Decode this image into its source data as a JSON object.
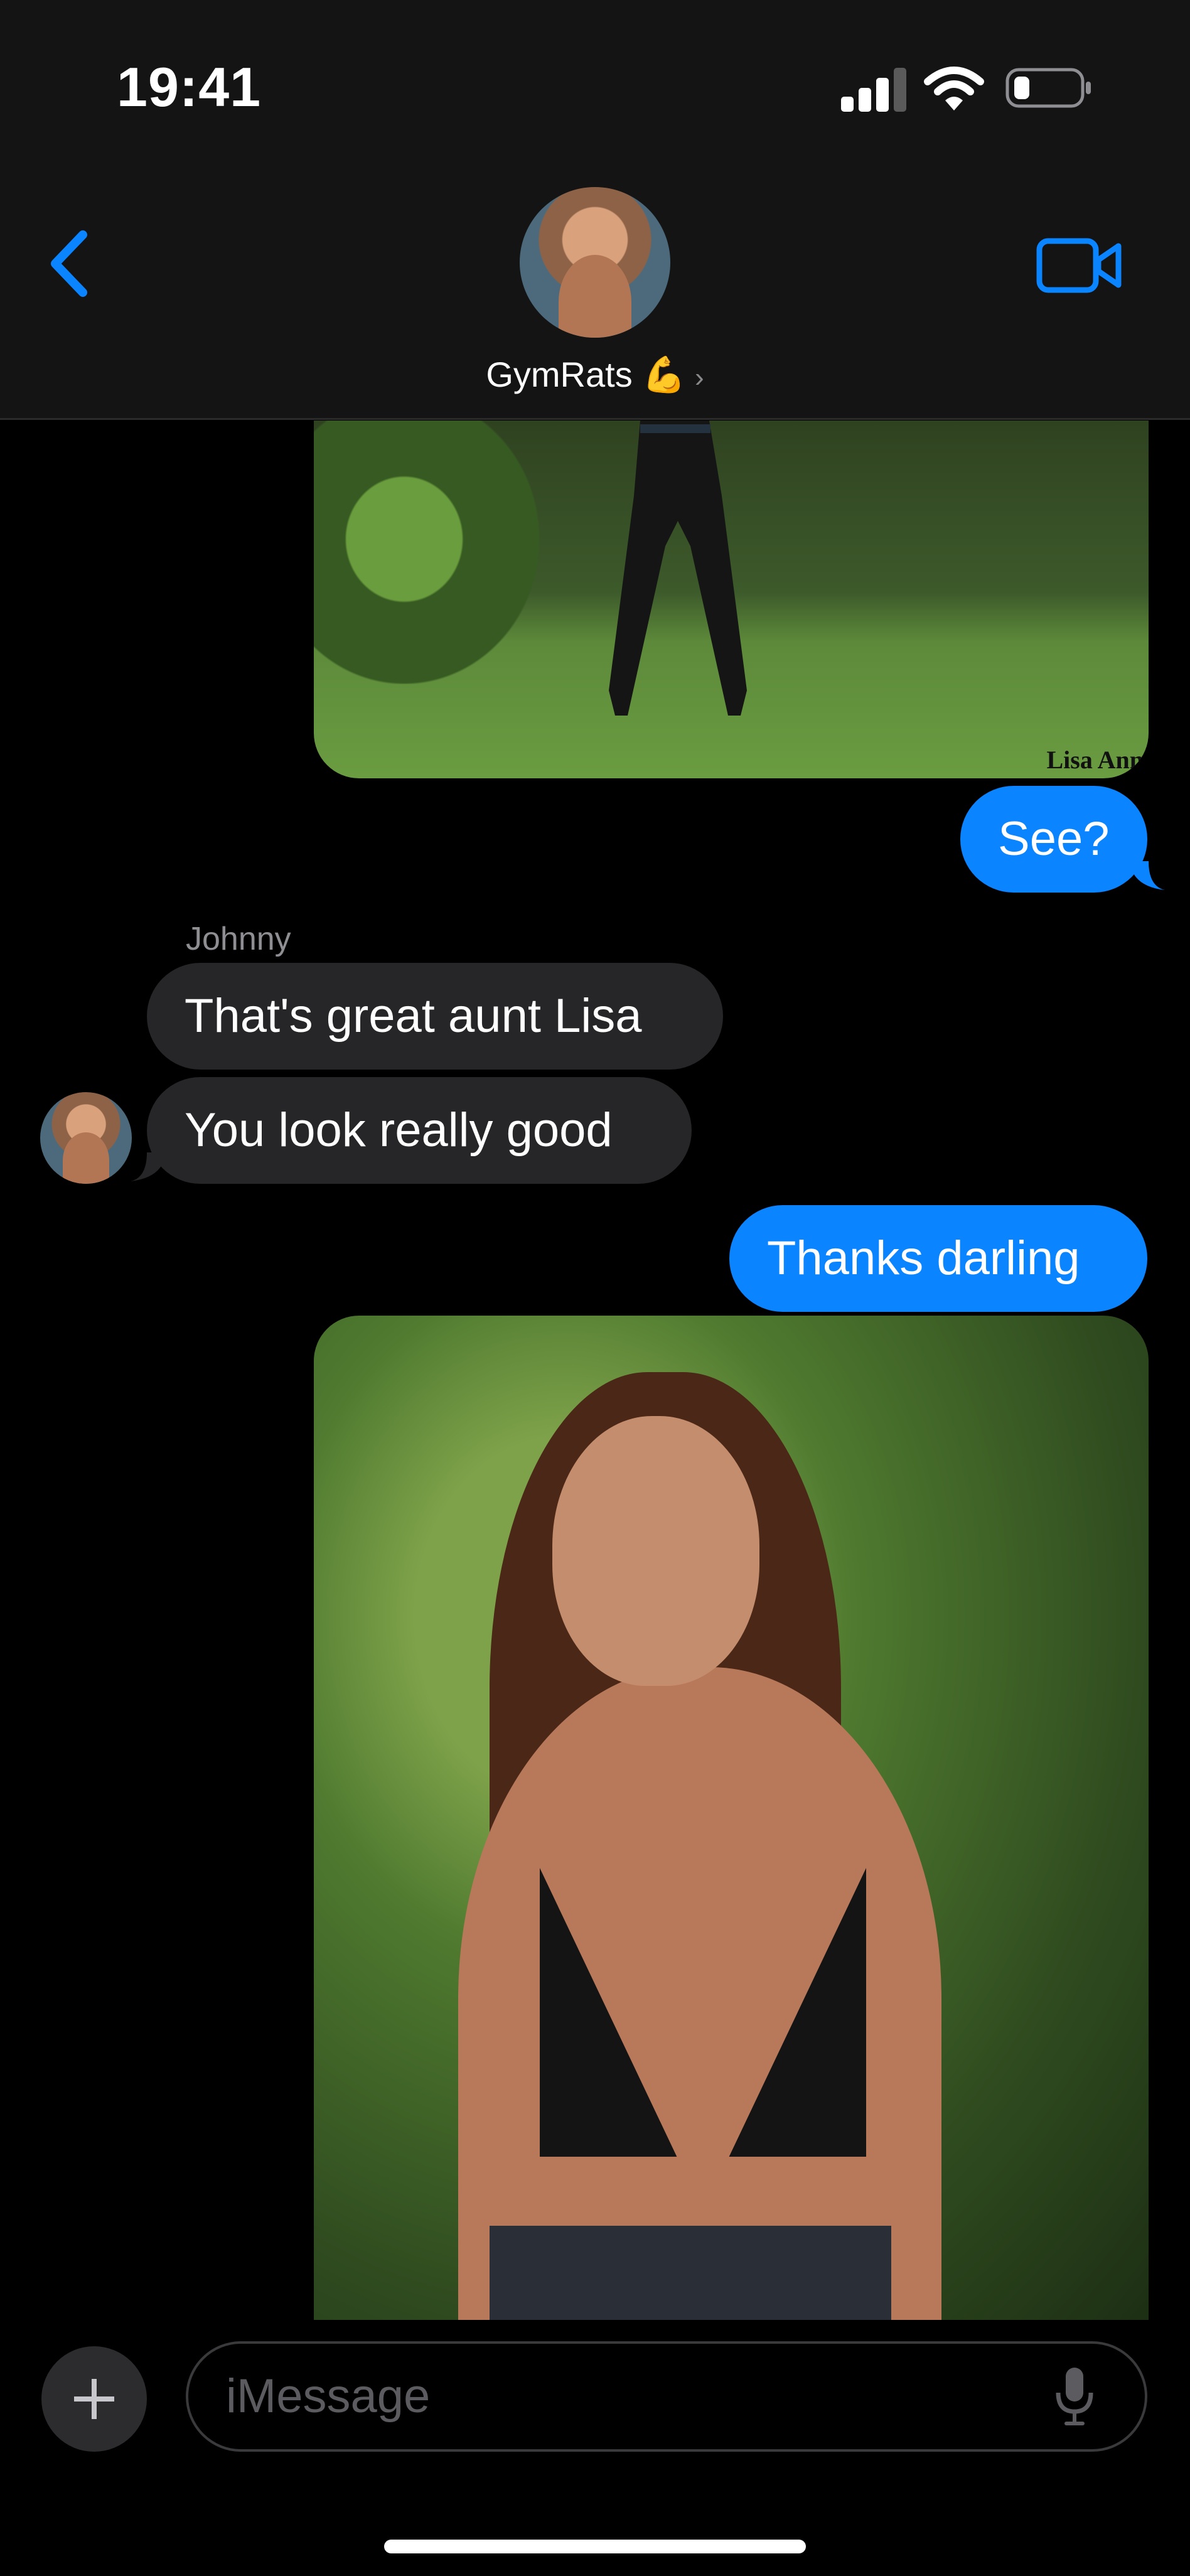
{
  "status_bar": {
    "time": "19:41"
  },
  "header": {
    "group_name": "GymRats 💪",
    "chevron": "›"
  },
  "messages": [
    {
      "type": "image",
      "from": "me",
      "watermark": "Lisa Ann"
    },
    {
      "type": "text",
      "from": "me",
      "text": "See?"
    },
    {
      "type": "sender",
      "text": "Johnny"
    },
    {
      "type": "text",
      "from": "Johnny",
      "text": "That's great aunt Lisa"
    },
    {
      "type": "text",
      "from": "Johnny",
      "text": "You look really good"
    },
    {
      "type": "text",
      "from": "me",
      "text": "Thanks darling"
    },
    {
      "type": "image",
      "from": "me"
    }
  ],
  "input": {
    "placeholder": "iMessage"
  },
  "colors": {
    "outgoing": "#0a84ff",
    "incoming": "#262628",
    "accent": "#0a84ff"
  },
  "icons": [
    "back-chevron-icon",
    "video-call-icon",
    "plus-icon",
    "mic-icon",
    "signal-icon",
    "wifi-icon",
    "battery-icon"
  ]
}
